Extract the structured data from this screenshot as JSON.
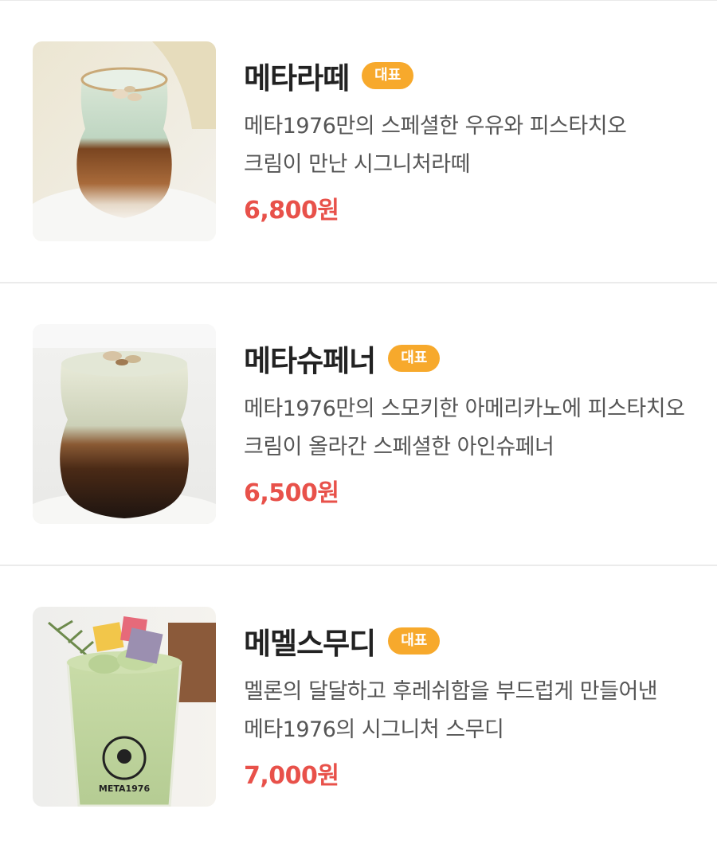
{
  "menu": {
    "items": [
      {
        "name": "메타라떼",
        "badge": "대표",
        "description": "메타1976만의 스페셜한 우유와 피스타치오 크림이 만난 시그니처라떼",
        "price": "6,800원"
      },
      {
        "name": "메타슈페너",
        "badge": "대표",
        "description": "메타1976만의 스모키한 아메리카노에 피스타치오 크림이 올라간 스페셜한 아인슈페너",
        "price": "6,500원"
      },
      {
        "name": "메멜스무디",
        "badge": "대표",
        "description": "멜론의 달달하고 후레쉬함을 부드럽게 만들어낸 메타1976의 시그니처 스무디",
        "price": "7,000원",
        "cup_logo": "META1976"
      }
    ]
  },
  "colors": {
    "badge": "#f7a92c",
    "price": "#e8514a",
    "name": "#222222",
    "description": "#555555"
  }
}
